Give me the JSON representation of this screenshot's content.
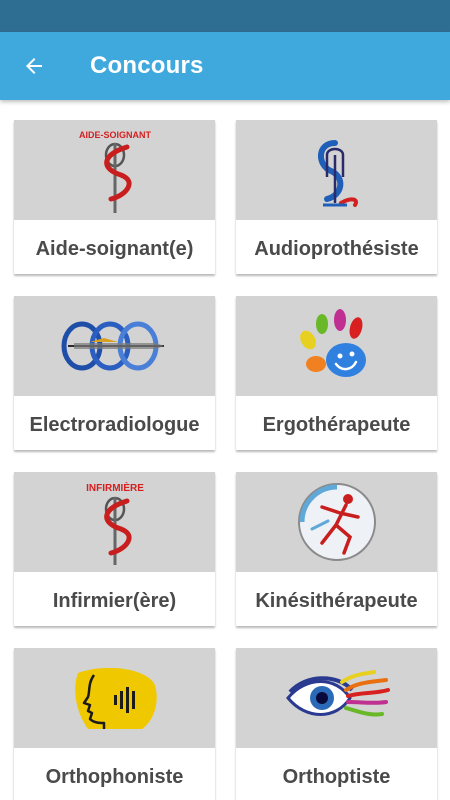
{
  "app": {
    "title": "Concours",
    "colors": {
      "status_bar": "#2f6e93",
      "app_bar": "#3fa8dd",
      "thumb_bg": "#d3d3d3",
      "label": "#4a4a4a"
    }
  },
  "cards": [
    {
      "label": "Aide-soignant(e)",
      "logo_text": "AIDE-SOIGNANT",
      "icon": "caduceus-aide-soignant-icon"
    },
    {
      "label": "Audioprothésiste",
      "icon": "audio-caduceus-icon"
    },
    {
      "label": "Electroradiologue",
      "icon": "electroradiology-rings-icon"
    },
    {
      "label": "Ergothérapeute",
      "icon": "hand-paint-icon"
    },
    {
      "label": "Infirmier(ère)",
      "logo_text": "INFIRMIÈRE",
      "icon": "caduceus-nurse-icon"
    },
    {
      "label": "Kinésithérapeute",
      "icon": "physio-figure-icon"
    },
    {
      "label": "Orthophoniste",
      "icon": "speaking-face-icon"
    },
    {
      "label": "Orthoptiste",
      "icon": "colorful-eye-icon"
    }
  ]
}
